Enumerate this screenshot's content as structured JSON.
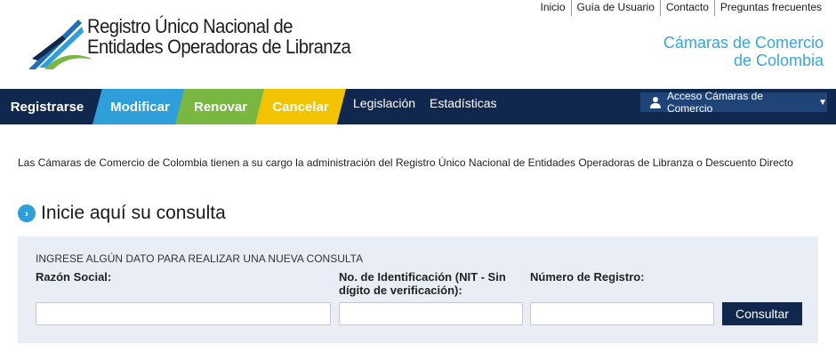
{
  "top_links": [
    "Inicio",
    "Guía de Usuario",
    "Contacto",
    "Preguntas frecuentes"
  ],
  "logo": {
    "line1": "Registro Único Nacional de",
    "line2": "Entidades Operadoras de Libranza"
  },
  "camaras": {
    "line1": "Cámaras de Comercio",
    "line2": "de Colombia"
  },
  "nav": {
    "registrarse": "Registrarse",
    "modificar": "Modificar",
    "renovar": "Renovar",
    "cancelar": "Cancelar",
    "legislacion": "Legislación",
    "estadisticas": "Estadísticas",
    "acceso": "Acceso Cámaras de Comercio"
  },
  "colors": {
    "navy": "#10284e",
    "blue": "#2e9fd9",
    "green": "#7ab642",
    "yellow": "#f3c300"
  },
  "intro": "Las Cámaras de Comercio de Colombia tienen a su cargo la administración del Registro Único Nacional de Entidades Operadoras de Libranza o Descuento Directo",
  "heading": "Inicie aquí su consulta",
  "form": {
    "legend": "INGRESE ALGÚN DATO PARA REALIZAR UNA NUEVA CONSULTA",
    "razon_label": "Razón Social:",
    "nit_label": "No. de Identificación (NIT - Sin dígito de verificación):",
    "registro_label": "Número de Registro:",
    "razon_value": "",
    "nit_value": "",
    "registro_value": "",
    "submit": "Consultar"
  }
}
